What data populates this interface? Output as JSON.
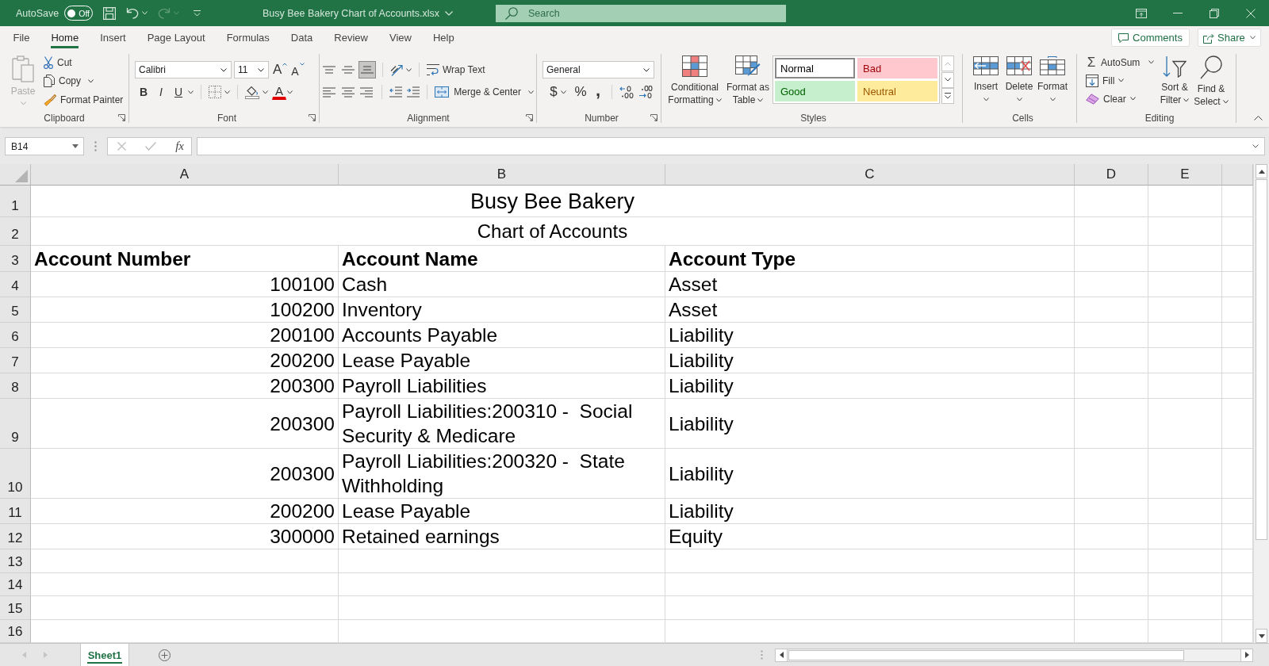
{
  "title_bar": {
    "autosave": {
      "label": "AutoSave",
      "toggle_text": "Off",
      "on": false
    },
    "quick_access": [
      {
        "kind": "save",
        "disabled": false
      },
      {
        "kind": "undo",
        "disabled": false
      },
      {
        "kind": "redo",
        "disabled": true
      }
    ],
    "file_name": "Busy Bee Bakery Chart of Accounts.xlsx",
    "search": {
      "placeholder": "Search"
    }
  },
  "menu_tabs": [
    {
      "label": "File",
      "selected": false
    },
    {
      "label": "Home",
      "selected": true
    },
    {
      "label": "Insert",
      "selected": false
    },
    {
      "label": "Page Layout",
      "selected": false
    },
    {
      "label": "Formulas",
      "selected": false
    },
    {
      "label": "Data",
      "selected": false
    },
    {
      "label": "Review",
      "selected": false
    },
    {
      "label": "View",
      "selected": false
    },
    {
      "label": "Help",
      "selected": false
    }
  ],
  "share_bar": {
    "comments": "Comments",
    "share": "Share"
  },
  "ribbon": {
    "clipboard": {
      "label": "Clipboard",
      "paste": {
        "label": "Paste",
        "disabled": true
      },
      "commands": [
        {
          "kind": "cut",
          "label": "Cut"
        },
        {
          "kind": "copy",
          "label": "Copy"
        },
        {
          "kind": "format_painter",
          "label": "Format Painter"
        }
      ]
    },
    "font": {
      "label": "Font",
      "font_name": "Calibri",
      "font_size": "11",
      "grow": "A",
      "shrink": "A",
      "styles": [
        {
          "kind": "bold",
          "label": "B"
        },
        {
          "kind": "italic",
          "label": "I"
        },
        {
          "kind": "underline",
          "label": "U"
        }
      ],
      "font_color": "A"
    },
    "alignment": {
      "label": "Alignment",
      "vertical": [
        {
          "kind": "top",
          "selected": false
        },
        {
          "kind": "middle",
          "selected": false
        },
        {
          "kind": "bottom",
          "selected": true
        }
      ],
      "horizontal": [
        {
          "kind": "left",
          "selected": false
        },
        {
          "kind": "center",
          "selected": false
        },
        {
          "kind": "right",
          "selected": false
        }
      ],
      "wrap_text": "Wrap Text",
      "merge": "Merge & Center"
    },
    "number": {
      "label": "Number",
      "format": "General",
      "buttons": [
        {
          "kind": "currency",
          "label": "$"
        },
        {
          "kind": "percent",
          "label": "%"
        },
        {
          "kind": "comma",
          "label": ","
        }
      ]
    },
    "styles": {
      "label": "Styles",
      "conditional": "Conditional Formatting",
      "format_table": "Format as Table",
      "gallery": [
        {
          "kind": "normal",
          "label": "Normal",
          "selected": true
        },
        {
          "kind": "bad",
          "label": "Bad",
          "selected": false
        },
        {
          "kind": "good",
          "label": "Good",
          "selected": false
        },
        {
          "kind": "neutral",
          "label": "Neutral",
          "selected": false
        }
      ]
    },
    "cells": {
      "label": "Cells",
      "commands": [
        {
          "kind": "insert",
          "label": "Insert"
        },
        {
          "kind": "delete",
          "label": "Delete"
        },
        {
          "kind": "format",
          "label": "Format"
        }
      ]
    },
    "editing": {
      "label": "Editing",
      "autosum": {
        "symbol": "Σ",
        "label": "AutoSum"
      },
      "fill": "Fill",
      "clear": "Clear",
      "sort": "Sort & Filter",
      "find": "Find & Select"
    }
  },
  "formula_bar": {
    "name_box": "B14",
    "edit_buttons": [
      {
        "kind": "cancel",
        "disabled": true
      },
      {
        "kind": "enter",
        "disabled": true
      }
    ],
    "fx": "fx"
  },
  "sheet": {
    "columns": [
      "A",
      "B",
      "C",
      "D",
      "E"
    ],
    "row_numbers": [
      "1",
      "2",
      "3",
      "4",
      "5",
      "6",
      "7",
      "8",
      "9",
      "10",
      "11",
      "12",
      "13",
      "14",
      "15",
      "16"
    ],
    "title": "Busy Bee Bakery",
    "subtitle": "Chart of Accounts",
    "header": {
      "number": "Account Number",
      "name": "Account Name",
      "type": "Account Type"
    },
    "accounts": [
      {
        "number": "100100",
        "name": "Cash",
        "type": "Asset"
      },
      {
        "number": "100200",
        "name": "Inventory",
        "type": "Asset"
      },
      {
        "number": "200100",
        "name": "Accounts Payable",
        "type": "Liability"
      },
      {
        "number": "200200",
        "name": "Lease Payable",
        "type": "Liability"
      },
      {
        "number": "200300",
        "name": "Payroll Liabilities",
        "type": "Liability"
      },
      {
        "number": "200300",
        "name": "Payroll Liabilities:200310 -  Social Security & Medicare",
        "type": "Liability"
      },
      {
        "number": "200300",
        "name": "Payroll Liabilities:200320 -  State Withholding",
        "type": "Liability"
      },
      {
        "number": "200200",
        "name": "Lease Payable",
        "type": "Liability"
      },
      {
        "number": "300000",
        "name": "Retained earnings",
        "type": "Equity"
      }
    ]
  },
  "sheet_tabs": [
    {
      "label": "Sheet1",
      "selected": true
    }
  ]
}
